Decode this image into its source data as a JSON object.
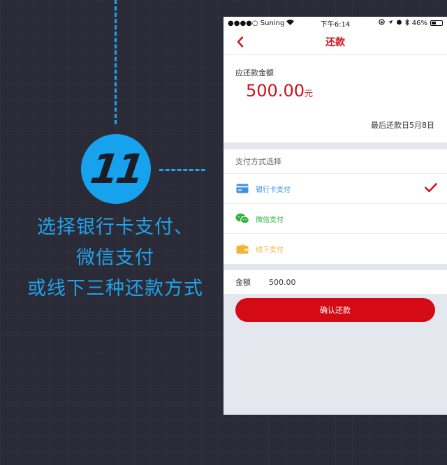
{
  "annotation": {
    "step_number": "11",
    "caption_lines": [
      "选择银行卡支付、",
      "微信支付",
      "或线下三种还款方式"
    ]
  },
  "status_bar": {
    "carrier": "●●●●○ Suning",
    "time": "下午6:14",
    "battery": "46%",
    "battery_level": 0.46
  },
  "nav": {
    "title": "还款",
    "back_icon": "chevron-left-icon"
  },
  "due": {
    "label": "应还款金额",
    "amount": "500.00",
    "unit": "元",
    "deadline": "最后还款日5月8日"
  },
  "payment": {
    "header": "支付方式选择",
    "options": [
      {
        "label": "银行卡支付",
        "icon": "bank-card-icon",
        "color": "#3f8ee6",
        "selected": true
      },
      {
        "label": "微信支付",
        "icon": "wechat-icon",
        "color": "#2bb33a",
        "selected": false
      },
      {
        "label": "线下支付",
        "icon": "wallet-icon",
        "color": "#f2b33d",
        "selected": false
      }
    ]
  },
  "amount_row": {
    "label": "金额",
    "value": "500.00"
  },
  "confirm_button": {
    "label": "确认还款"
  },
  "colors": {
    "accent": "#d0101b",
    "annotation_blue": "#1fa3ea",
    "background": "#2b2b38"
  }
}
